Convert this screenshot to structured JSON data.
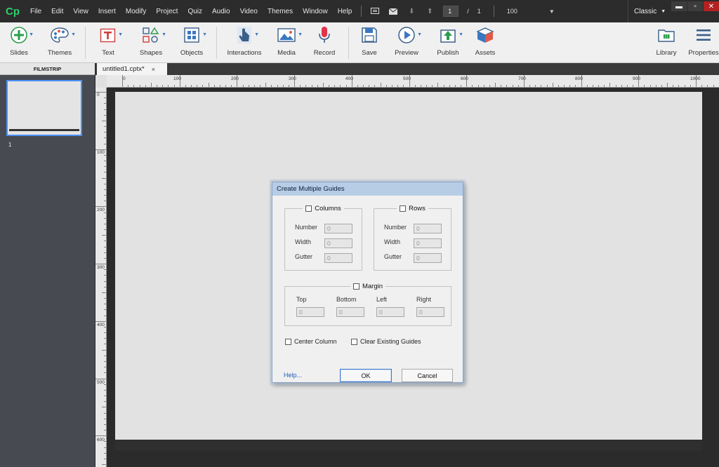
{
  "app": {
    "logo": "Cp"
  },
  "menu": [
    "File",
    "Edit",
    "View",
    "Insert",
    "Modify",
    "Project",
    "Quiz",
    "Audio",
    "Video",
    "Themes",
    "Window",
    "Help"
  ],
  "nav": {
    "slide_current": "1",
    "slide_sep": "/",
    "slide_total": "1",
    "zoom": "100"
  },
  "workspace": "Classic",
  "toolbar": {
    "slides": "Slides",
    "themes": "Themes",
    "text": "Text",
    "shapes": "Shapes",
    "objects": "Objects",
    "interactions": "Interactions",
    "media": "Media",
    "record": "Record",
    "save": "Save",
    "preview": "Preview",
    "publish": "Publish",
    "assets": "Assets",
    "library": "Library",
    "properties": "Properties"
  },
  "filmstrip": {
    "header": "FILMSTRIP",
    "thumb_number": "1"
  },
  "tab": {
    "name": "untitled1.cptx*",
    "close": "×"
  },
  "ruler": {
    "top": [
      "0",
      "100",
      "200",
      "300",
      "400",
      "500",
      "600",
      "700",
      "800",
      "900",
      "1000"
    ],
    "left": [
      "0",
      "100",
      "200",
      "300",
      "400",
      "500",
      "600"
    ]
  },
  "dialog": {
    "title": "Create Multiple Guides",
    "columns": {
      "label": "Columns",
      "number_label": "Number",
      "width_label": "Width",
      "gutter_label": "Gutter",
      "number": "0",
      "width": "0",
      "gutter": "0"
    },
    "rows": {
      "label": "Rows",
      "number_label": "Number",
      "width_label": "Width",
      "gutter_label": "Gutter",
      "number": "0",
      "width": "0",
      "gutter": "0"
    },
    "margin": {
      "label": "Margin",
      "top_label": "Top",
      "bottom_label": "Bottom",
      "left_label": "Left",
      "right_label": "Right",
      "top": "0",
      "bottom": "0",
      "left": "0",
      "right": "0"
    },
    "center_column": "Center Column",
    "clear_guides": "Clear Existing Guides",
    "help": "Help...",
    "ok": "OK",
    "cancel": "Cancel"
  },
  "colors": {
    "accent": "#2bd16c",
    "selection": "#4a8ff5",
    "dialog_title": "#b7cde6"
  }
}
